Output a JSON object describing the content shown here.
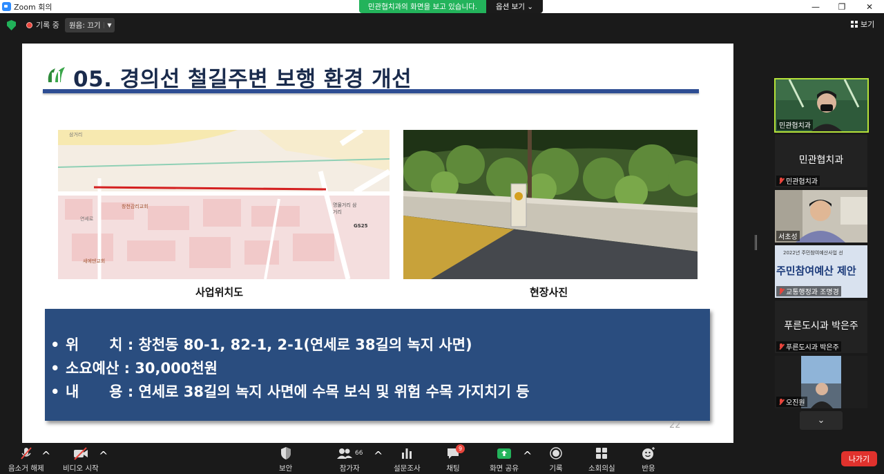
{
  "window": {
    "title": "Zoom 회의",
    "minimize": "—",
    "maximize": "❐",
    "close": "✕"
  },
  "share_banner": {
    "message": "민관협치과의 화면을 보고 있습니다.",
    "options": "옵션 보기 ⌄"
  },
  "meeting": {
    "recording": "기록 중",
    "audio_label": "원음: 끄기",
    "view_label": "보기"
  },
  "slide": {
    "title": "05. 경의선 철길주변 보행 환경 개선",
    "caption_map": "사업위치도",
    "caption_photo": "현장사진",
    "info": [
      {
        "bullet": "•",
        "text": "위      치 : 창천동 80-1, 82-1, 2-1(연세로 38길의 녹지 사면)"
      },
      {
        "bullet": "•",
        "text": "소요예산 : 30,000천원"
      },
      {
        "bullet": "•",
        "text": "내      용 : 연세로 38길의 녹지 사면에 수목 보식 및 위험 수목 가지치기 등"
      }
    ],
    "page_number": "22",
    "map_labels": {
      "a": "창천감리교회",
      "b": "GS25",
      "c": "명물거리 삼거리",
      "d": "연세로",
      "e": "새에덴교회",
      "f": "삼거리"
    }
  },
  "participants": [
    {
      "name": "민관협치과",
      "type": "video"
    },
    {
      "name": "민관협치과",
      "type": "name",
      "display": "민관협치과"
    },
    {
      "name": "서초성",
      "type": "video"
    },
    {
      "name": "교통행정과 조명경",
      "type": "video",
      "poster_text_1": "2022년 주민참여예산사업 선",
      "poster_text_2": "주민참여예산 제안"
    },
    {
      "name": "푸른도시과 박은주",
      "type": "name",
      "display": "푸른도시과 박은주"
    },
    {
      "name": "오진원",
      "type": "video"
    }
  ],
  "toolbar": {
    "unmute": "음소거 해제",
    "start_video": "비디오 시작",
    "security": "보안",
    "participants": "참가자",
    "participants_count": "66",
    "polls": "설문조사",
    "chat": "채팅",
    "chat_badge": "9",
    "share": "화면 공유",
    "record": "기록",
    "breakout": "소회의실",
    "reactions": "반응",
    "leave": "나가기"
  },
  "colors": {
    "zoom_green": "#23b35b",
    "leave_red": "#e0322d",
    "slide_navy": "#2a4d7f",
    "title_rule": "#2e4e93"
  }
}
